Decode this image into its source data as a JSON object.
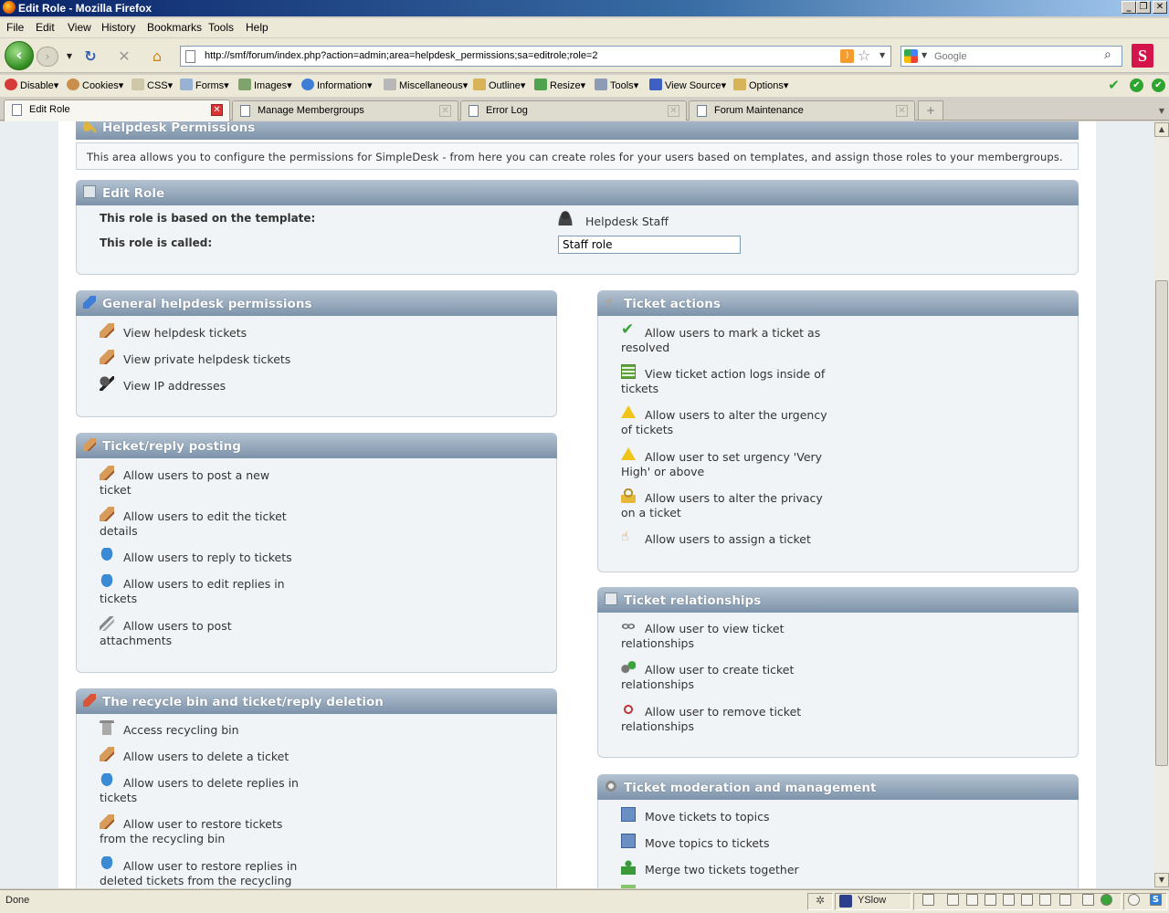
{
  "window": {
    "title": "Edit Role - Mozilla Firefox"
  },
  "menubar": [
    "File",
    "Edit",
    "View",
    "History",
    "Bookmarks",
    "Tools",
    "Help"
  ],
  "nav": {
    "url": "http://smf/forum/index.php?action=admin;area=helpdesk_permissions;sa=editrole;role=2",
    "search_placeholder": "Google"
  },
  "devtoolbar": [
    "Disable",
    "Cookies",
    "CSS",
    "Forms",
    "Images",
    "Information",
    "Miscellaneous",
    "Outline",
    "Resize",
    "Tools",
    "View Source",
    "Options"
  ],
  "tabs": [
    "Edit Role",
    "Manage Membergroups",
    "Error Log",
    "Forum Maintenance"
  ],
  "page": {
    "header_title": "Helpdesk Permissions",
    "description": "This area allows you to configure the permissions for SimpleDesk - from here you can create roles for your users based on templates, and assign those roles to your membergroups.",
    "edit_role": {
      "title": "Edit Role",
      "template_label": "This role is based on the template:",
      "template_value": "Helpdesk Staff",
      "called_label": "This role is called:",
      "called_value": "Staff role"
    },
    "general": {
      "title": "General helpdesk permissions",
      "items": [
        "View helpdesk tickets",
        "View private helpdesk tickets",
        "View IP addresses"
      ]
    },
    "posting": {
      "title": "Ticket/reply posting",
      "items": [
        [
          "Allow users to post a new",
          "ticket"
        ],
        [
          "Allow users to edit the ticket",
          "details"
        ],
        [
          "Allow users to reply to tickets"
        ],
        [
          "Allow users to edit replies in",
          "tickets"
        ],
        [
          "Allow users to post",
          "attachments"
        ]
      ]
    },
    "recycle": {
      "title": "The recycle bin and ticket/reply deletion",
      "items": [
        [
          "Access recycling bin"
        ],
        [
          "Allow users to delete a ticket"
        ],
        [
          "Allow users to delete replies in",
          "tickets"
        ],
        [
          "Allow user to restore tickets",
          "from the recycling bin"
        ],
        [
          "Allow user to restore replies in",
          "deleted tickets from the recycling"
        ]
      ]
    },
    "actions": {
      "title": "Ticket actions",
      "items": [
        [
          "Allow users to mark a ticket as",
          "resolved"
        ],
        [
          "View ticket action logs inside of",
          "tickets"
        ],
        [
          "Allow users to alter the urgency",
          "of tickets"
        ],
        [
          "Allow user to set urgency 'Very",
          "High' or above"
        ],
        [
          "Allow users to alter the privacy",
          "on a ticket"
        ],
        [
          "Allow users to assign a ticket"
        ]
      ]
    },
    "relationships": {
      "title": "Ticket relationships",
      "items": [
        [
          "Allow user to view ticket",
          "relationships"
        ],
        [
          "Allow user to create ticket",
          "relationships"
        ],
        [
          "Allow user to remove ticket",
          "relationships"
        ]
      ]
    },
    "moderation": {
      "title": "Ticket moderation and management",
      "items": [
        "Move tickets to topics",
        "Move topics to tickets",
        "Merge two tickets together"
      ]
    }
  },
  "status": {
    "text": "Done",
    "yslow": "YSlow"
  }
}
